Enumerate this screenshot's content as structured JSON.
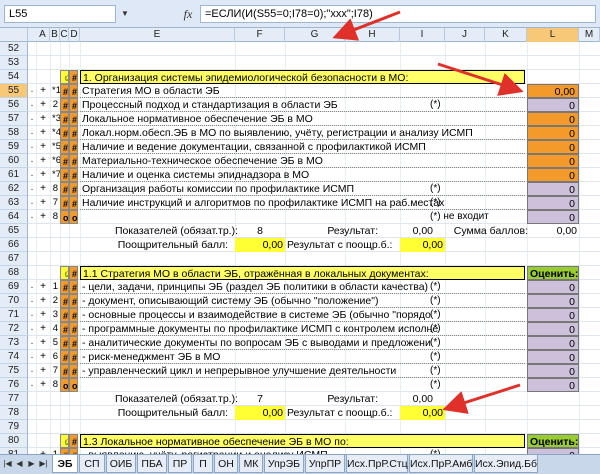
{
  "formula_bar": {
    "name_box": "L55",
    "fx_label": "fx",
    "formula": "=ЕСЛИ(И(S55=0;I78=0);\"ххх\";I78)"
  },
  "columns": [
    "A",
    "B",
    "C",
    "D",
    "E",
    "F",
    "G",
    "H",
    "I",
    "J",
    "K",
    "L",
    "M"
  ],
  "rows": [
    {
      "n": "52"
    },
    {
      "n": "53"
    },
    {
      "n": "54",
      "c": "☺",
      "d": "#",
      "text": "1.  Организация системы эпидемиологической безопасности в МО:",
      "header": true
    },
    {
      "n": "55",
      "lvl": "·",
      "a": "+",
      "b": "*1",
      "c": "#",
      "d": "#",
      "text": "Стратегия МО в области ЭБ",
      "l": "0,00",
      "lcls": "orange",
      "sel": true
    },
    {
      "n": "56",
      "lvl": "·",
      "a": "+",
      "b": "2",
      "c": "#",
      "d": "#",
      "text": "Процессный подход и стандартизация в области ЭБ",
      "star": "(*)",
      "l": "0",
      "lcls": "lav"
    },
    {
      "n": "57",
      "lvl": "·",
      "a": "+",
      "b": "*3",
      "c": "#",
      "d": "#",
      "text": "Локальное нормативное обеспечение ЭБ в МО",
      "l": "0",
      "lcls": "orange"
    },
    {
      "n": "58",
      "lvl": "·",
      "a": "+",
      "b": "*4",
      "c": "#",
      "d": "#",
      "text": "Локал.норм.обесп.ЭБ в МО по выявлению, учёту, регистрации и анализу ИСМП",
      "l": "0",
      "lcls": "orange"
    },
    {
      "n": "59",
      "lvl": "·",
      "a": "+",
      "b": "*5",
      "c": "#",
      "d": "#",
      "text": "Наличие и ведение документации, связанной с профилактикой ИСМП",
      "l": "0",
      "lcls": "orange"
    },
    {
      "n": "60",
      "lvl": "·",
      "a": "+",
      "b": "*6",
      "c": "#",
      "d": "#",
      "text": "Материально-техническое обеспечение ЭБ в МО",
      "l": "0",
      "lcls": "orange"
    },
    {
      "n": "61",
      "lvl": "·",
      "a": "+",
      "b": "*7",
      "c": "#",
      "d": "#",
      "text": "Наличие и оценка системы эпиднадзора в МО",
      "l": "0",
      "lcls": "orange"
    },
    {
      "n": "62",
      "lvl": "·",
      "a": "+",
      "b": "8",
      "c": "#",
      "d": "#",
      "text": "Организация работы комиссии по профилактике ИСМП",
      "star": "(*)",
      "l": "0",
      "lcls": "lav"
    },
    {
      "n": "63",
      "lvl": "·",
      "a": "+",
      "b": "7",
      "c": "#",
      "d": "#",
      "text": "Наличие инструкций и алгоритмов по профилактике ИСМП на раб.местах",
      "star": "(*)",
      "l": "0",
      "lcls": "lav"
    },
    {
      "n": "64",
      "lvl": "·",
      "a": "+",
      "b": "8",
      "c": "o",
      "d": "o",
      "text": "",
      "star": "(*) не входит",
      "l": "0",
      "lcls": "lav"
    },
    {
      "n": "65",
      "summary1": true
    },
    {
      "n": "66",
      "summary2": true
    },
    {
      "n": "67"
    },
    {
      "n": "68",
      "c": "☺",
      "d": "#",
      "text": "1.1 Стратегия МО в области ЭБ, отражённая в локальных документах:",
      "header": true,
      "l": "Оценить:",
      "lcls": "green"
    },
    {
      "n": "69",
      "lvl": "·",
      "a": "+",
      "b": "1",
      "c": "#",
      "d": "#",
      "text": "- цели, задачи, принципы ЭБ (раздел ЭБ политики в области качества)",
      "star": "(*)",
      "l": "0",
      "lcls": "lav"
    },
    {
      "n": "70",
      "lvl": "·",
      "a": "+",
      "b": "2",
      "c": "#",
      "d": "#",
      "text": "- документ, описывающий систему ЭБ (обычно \"положение\")",
      "star": "(*)",
      "l": "0",
      "lcls": "lav"
    },
    {
      "n": "71",
      "lvl": "·",
      "a": "+",
      "b": "3",
      "c": "#",
      "d": "#",
      "text": "- основные процессы и взаимодействие в системе ЭБ (обычно \"порядо",
      "star": "(*)",
      "l": "0",
      "lcls": "lav"
    },
    {
      "n": "72",
      "lvl": "·",
      "a": "+",
      "b": "4",
      "c": "#",
      "d": "#",
      "text": "- программные документы по профилактике ИСМП с контролем исполне",
      "star": "(*)",
      "l": "0",
      "lcls": "lav"
    },
    {
      "n": "73",
      "lvl": "·",
      "a": "+",
      "b": "5",
      "c": "#",
      "d": "#",
      "text": "- аналитические документы по вопросам ЭБ с выводами и предложени",
      "star": "(*)",
      "l": "0",
      "lcls": "lav"
    },
    {
      "n": "74",
      "lvl": "·",
      "a": "+",
      "b": "6",
      "c": "#",
      "d": "#",
      "text": "- риск-менеджмент ЭБ в МО",
      "star": "(*)",
      "l": "0",
      "lcls": "lav"
    },
    {
      "n": "75",
      "lvl": "·",
      "a": "+",
      "b": "7",
      "c": "#",
      "d": "#",
      "text": "- управленческий цикл и непрерывное улучшение деятельности",
      "star": "(*)",
      "l": "0",
      "lcls": "lav"
    },
    {
      "n": "76",
      "lvl": "·",
      "a": "+",
      "b": "8",
      "c": "o",
      "d": "o",
      "text": "",
      "star": "(*)",
      "l": "0",
      "lcls": "lav"
    },
    {
      "n": "77",
      "summary3": true
    },
    {
      "n": "78",
      "summary4": true
    },
    {
      "n": "79"
    },
    {
      "n": "80",
      "c": "☺",
      "d": "#",
      "text": "1.3 Локальное нормативное обеспечение ЭБ в МО по:",
      "header": true,
      "l": "Оценить:",
      "lcls": "green"
    },
    {
      "n": "81",
      "lvl": "·",
      "a": "+",
      "b": "1",
      "c": "#",
      "d": "#",
      "text": "- выявлению, учёту, регистрации и анализу ИСМП",
      "star": "(*)",
      "l": "0",
      "lcls": "lav"
    }
  ],
  "summary": {
    "pokaz_label": "Показателей (обязат.тр.):",
    "pokaz_val_1": "8",
    "rezult_label": "Результат:",
    "rezult_val_1": "0,00",
    "sum_label": "Сумма баллов:",
    "sum_val": "0,00",
    "poosch_label": "Поощрительный балл:",
    "poosch_val_1": "0,00",
    "rez_poosch_label": "Результат с поощр.б.:",
    "rez_poosch_val_1": "0,00",
    "pokaz_val_2": "7",
    "rezult_val_2": "0,00",
    "poosch_val_2": "0,00",
    "rez_poosch_val_2": "0,00"
  },
  "tabs": [
    "ЭБ",
    "СП",
    "ОИБ",
    "ПБА",
    "ПР",
    "П",
    "ОН",
    "МК",
    "УпрЭБ",
    "УпрПР",
    "Исх.ПрР.Стц",
    "Исх.ПрР.Амб",
    "Исх.Эпид.Бб"
  ],
  "active_tab": "ЭБ",
  "colors": {
    "orange": "#f39a2b",
    "lavender": "#ccc0da",
    "yellow": "#ffff33",
    "green": "#9acd32",
    "arrow": "#e0302a"
  }
}
